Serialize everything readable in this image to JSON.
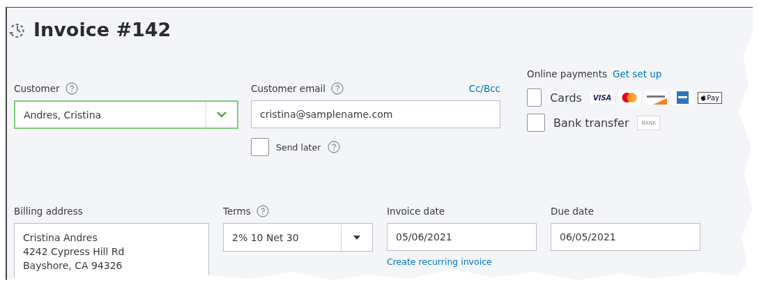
{
  "header": {
    "title": "Invoice #142"
  },
  "customer": {
    "label": "Customer",
    "value": "Andres, Cristina",
    "focused": true
  },
  "customer_email": {
    "label": "Customer email",
    "value": "cristina@samplename.com",
    "cc_bcc": "Cc/Bcc",
    "send_later": {
      "label": "Send later",
      "checked": false
    }
  },
  "online_payments": {
    "label": "Online payments",
    "link": "Get set up",
    "options": [
      {
        "kind": "cards",
        "label": "Cards",
        "checked": false,
        "visa": "VISA",
        "applepay": "Pay"
      },
      {
        "kind": "bank",
        "label": "Bank transfer",
        "checked": false,
        "badge": "BANK"
      }
    ]
  },
  "billing_address": {
    "label": "Billing address",
    "lines": [
      "Cristina Andres",
      "4242 Cypress Hill Rd",
      "Bayshore, CA  94326"
    ]
  },
  "terms": {
    "label": "Terms",
    "value": "2% 10 Net 30"
  },
  "invoice_date": {
    "label": "Invoice date",
    "value": "05/06/2021",
    "link": "Create recurring invoice"
  },
  "due_date": {
    "label": "Due date",
    "value": "06/05/2021"
  }
}
